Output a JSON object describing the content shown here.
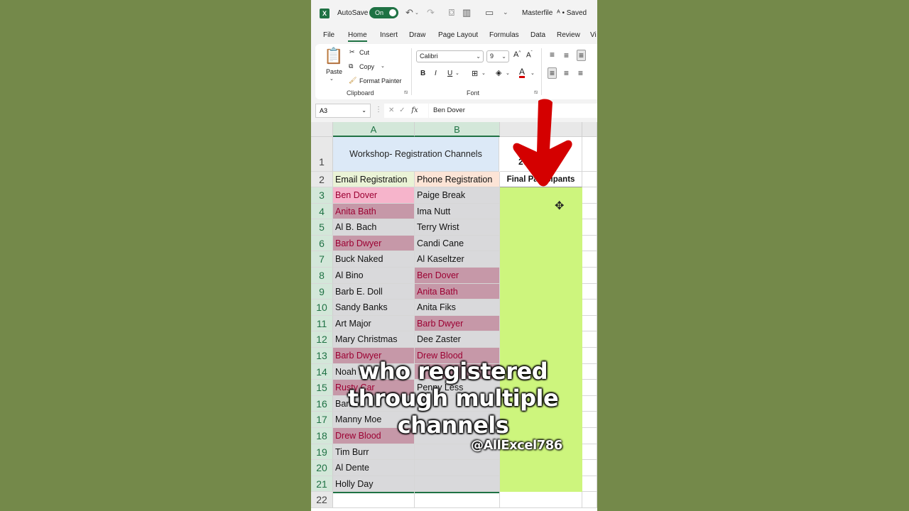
{
  "titlebar": {
    "app_icon": "excel-icon",
    "autosave_label": "AutoSave",
    "autosave_state": "On",
    "filename": "Masterfile",
    "save_status": "Saved"
  },
  "tabs": [
    "File",
    "Home",
    "Insert",
    "Draw",
    "Page Layout",
    "Formulas",
    "Data",
    "Review",
    "Vi"
  ],
  "ribbon": {
    "paste": "Paste",
    "cut": "Cut",
    "copy": "Copy",
    "format_painter": "Format Painter",
    "clipboard_label": "Clipboard",
    "font_name": "Calibri",
    "font_size": "9",
    "font_label": "Font",
    "bold": "B",
    "italic": "I",
    "underline": "U"
  },
  "formula_bar": {
    "name_box": "A3",
    "fx": "fx",
    "formula": "Ben Dover"
  },
  "sheet": {
    "columns": [
      "A",
      "B"
    ],
    "title": "Workshop- Registration Channels",
    "c1_partial": "27",
    "headers": {
      "a": "Email Registration",
      "b": "Phone Registration",
      "c": "Final Participants"
    },
    "rows": [
      {
        "n": "1"
      },
      {
        "n": "2"
      },
      {
        "n": "3",
        "a": "Ben Dover",
        "b": "Paige Break"
      },
      {
        "n": "4",
        "a": "Anita Bath",
        "b": "Ima Nutt"
      },
      {
        "n": "5",
        "a": "Al B. Bach",
        "b": "Terry Wrist"
      },
      {
        "n": "6",
        "a": "Barb Dwyer",
        "b": "Candi Cane"
      },
      {
        "n": "7",
        "a": "Buck Naked",
        "b": "Al Kaseltzer"
      },
      {
        "n": "8",
        "a": "Al Bino",
        "b": "Ben Dover"
      },
      {
        "n": "9",
        "a": "Barb E. Doll",
        "b": "Anita Bath"
      },
      {
        "n": "10",
        "a": "Sandy Banks",
        "b": "Anita Fiks"
      },
      {
        "n": "11",
        "a": "Art Major",
        "b": "Barb Dwyer"
      },
      {
        "n": "12",
        "a": "Mary Christmas",
        "b": "Dee Zaster"
      },
      {
        "n": "13",
        "a": "Barb Dwyer",
        "b": "Drew Blood"
      },
      {
        "n": "14",
        "a": "Noah I",
        "b": ""
      },
      {
        "n": "15",
        "a": "Rusty Car",
        "b": "Penny Less"
      },
      {
        "n": "16",
        "a": "Barb",
        "b": ""
      },
      {
        "n": "17",
        "a": "Manny Moe",
        "b": ""
      },
      {
        "n": "18",
        "a": "Drew Blood",
        "b": ""
      },
      {
        "n": "19",
        "a": "Tim Burr",
        "b": ""
      },
      {
        "n": "20",
        "a": "Al Dente",
        "b": ""
      },
      {
        "n": "21",
        "a": "Holly Day",
        "b": ""
      },
      {
        "n": "22"
      }
    ]
  },
  "overlay": {
    "caption_line1": "who registered",
    "caption_line2": "through multiple",
    "caption_line3": "channels",
    "handle": "@AllExcel786"
  },
  "colors": {
    "excel_green": "#1f7244",
    "duplicate_fill": "#c698a8",
    "duplicate_text": "#9c0032",
    "result_fill": "#cdf57d",
    "title_fill": "#dce9f7",
    "arrow": "#d40000"
  }
}
